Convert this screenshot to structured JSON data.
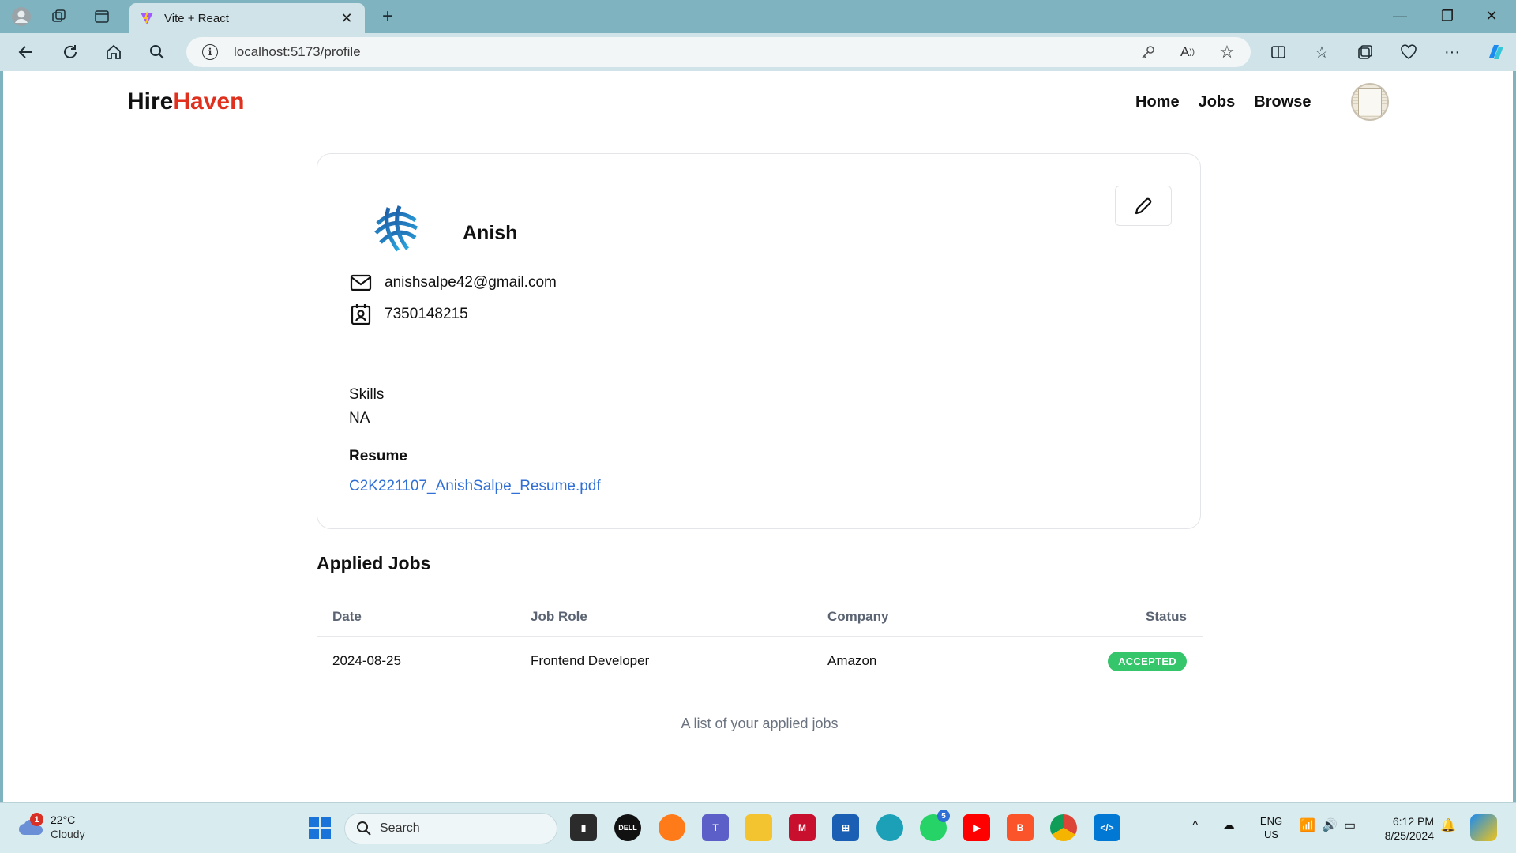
{
  "browser": {
    "tab_title": "Vite + React",
    "url": "localhost:5173/profile"
  },
  "site": {
    "logo_part1": "Hire",
    "logo_part2": "Haven",
    "nav": [
      "Home",
      "Jobs",
      "Browse"
    ]
  },
  "profile": {
    "name": "Anish",
    "email": "anishsalpe42@gmail.com",
    "phone": "7350148215",
    "skills_label": "Skills",
    "skills_value": "NA",
    "resume_label": "Resume",
    "resume_file": "C2K221107_AnishSalpe_Resume.pdf"
  },
  "applied_jobs": {
    "title": "Applied Jobs",
    "headers": [
      "Date",
      "Job Role",
      "Company",
      "Status"
    ],
    "rows": [
      {
        "date": "2024-08-25",
        "role": "Frontend Developer",
        "company": "Amazon",
        "status": "ACCEPTED"
      }
    ],
    "caption": "A list of your applied jobs"
  },
  "taskbar": {
    "weather_temp": "22°C",
    "weather_cond": "Cloudy",
    "weather_badge": "1",
    "search_placeholder": "Search",
    "whatsapp_badge": "5",
    "lang_top": "ENG",
    "lang_bottom": "US",
    "time": "6:12 PM",
    "date": "8/25/2024"
  },
  "colors": {
    "brand_accent": "#e0301e",
    "link": "#2f6fd6",
    "status_accepted": "#35c56b"
  }
}
